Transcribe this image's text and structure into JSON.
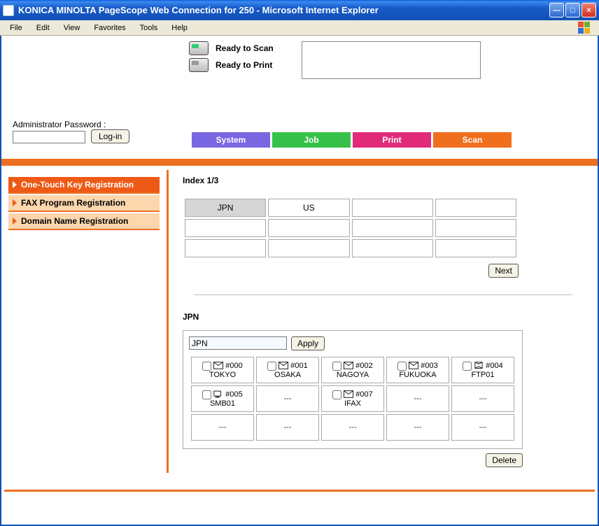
{
  "window": {
    "title": "KONICA MINOLTA PageScope Web Connection for 250 - Microsoft Internet Explorer"
  },
  "menubar": [
    "File",
    "Edit",
    "View",
    "Favorites",
    "Tools",
    "Help"
  ],
  "status": {
    "scan": "Ready to Scan",
    "print": "Ready to Print"
  },
  "login": {
    "label": "Administrator Password :",
    "button": "Log-in",
    "value": ""
  },
  "tabs": {
    "system": "System",
    "job": "Job",
    "print": "Print",
    "scan": "Scan"
  },
  "sidenav": {
    "items": [
      {
        "label": "One-Touch Key Registration",
        "selected": true
      },
      {
        "label": "FAX Program Registration",
        "selected": false
      },
      {
        "label": "Domain Name Registration",
        "selected": false
      }
    ]
  },
  "index": {
    "heading": "Index 1/3",
    "cells": [
      "JPN",
      "US",
      "",
      "",
      "",
      "",
      "",
      "",
      "",
      "",
      "",
      ""
    ],
    "selected": 0,
    "next": "Next"
  },
  "group": {
    "title": "JPN",
    "name_value": "JPN",
    "apply": "Apply",
    "delete": "Delete",
    "placeholder": "---",
    "dests": [
      {
        "idx": "#000",
        "name": "TOKYO",
        "type": "mail"
      },
      {
        "idx": "#001",
        "name": "OSAKA",
        "type": "mail"
      },
      {
        "idx": "#002",
        "name": "NAGOYA",
        "type": "mail"
      },
      {
        "idx": "#003",
        "name": "FUKUOKA",
        "type": "mail"
      },
      {
        "idx": "#004",
        "name": "FTP01",
        "type": "ftp"
      },
      {
        "idx": "#005",
        "name": "SMB01",
        "type": "smb"
      },
      null,
      {
        "idx": "#007",
        "name": "IFAX",
        "type": "mail"
      },
      null,
      null,
      null,
      null,
      null,
      null,
      null
    ]
  }
}
